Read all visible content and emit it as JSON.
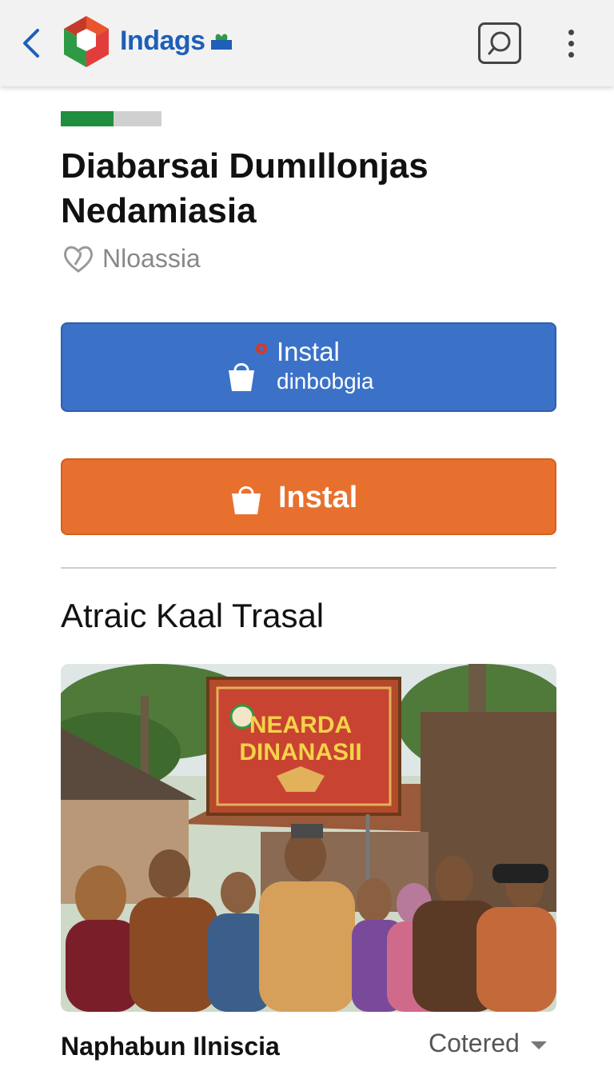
{
  "app_bar": {
    "brand": "Indags",
    "back_icon": "chevron-left-icon",
    "search_icon": "search-icon",
    "menu_icon": "more-vertical-icon"
  },
  "progress": {
    "value": 0.52,
    "fill_color": "#1f8f3d",
    "track_color": "#d0d0d0"
  },
  "page": {
    "title": "Diabarsai Dumıllonjas Nedamiasia",
    "location": "Nloassia",
    "location_icon": "heart-icon"
  },
  "primary_button": {
    "line1": "Instal",
    "line2": "dinbobgia",
    "icon": "shopping-bag-icon",
    "color": "#3b72c8"
  },
  "secondary_button": {
    "label": "Instal",
    "icon": "shopping-bag-icon",
    "color": "#e8702e"
  },
  "section": {
    "title": "Atraic Kaal Trasal",
    "banner_line1": "NEARDA",
    "banner_line2": "DINANASII"
  },
  "footer": {
    "label": "Naphabun Ilniscia",
    "select_value": "Cotered"
  }
}
